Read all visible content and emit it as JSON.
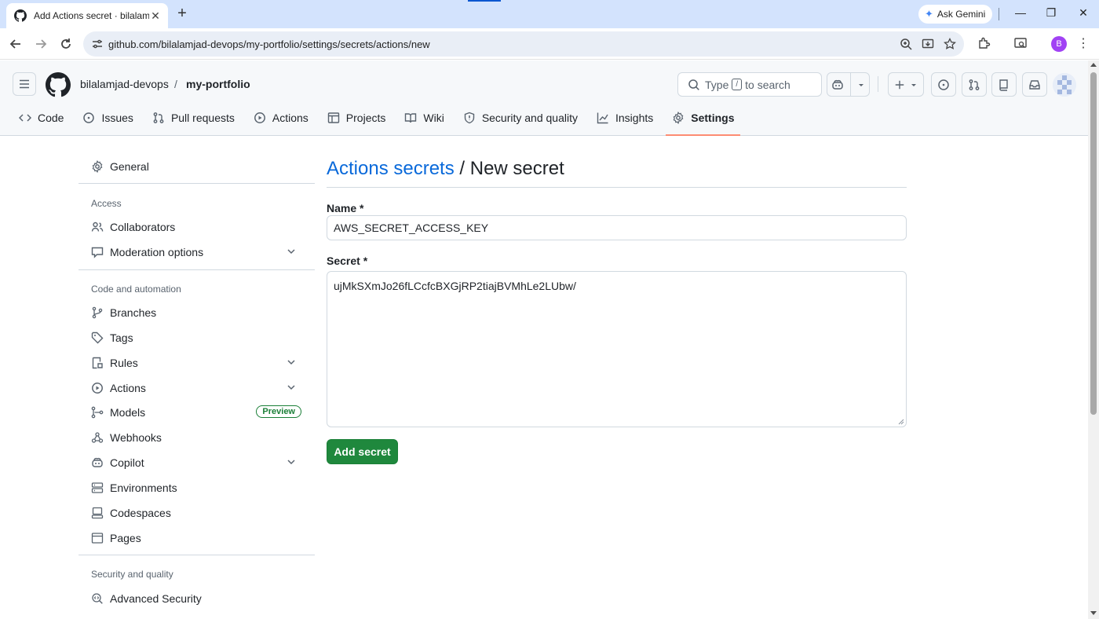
{
  "browser": {
    "tab_title": "Add Actions secret · bilalamjad-",
    "ask_gemini": "Ask Gemini",
    "url": "github.com/bilalamjad-devops/my-portfolio/settings/secrets/actions/new",
    "profile_initial": "B"
  },
  "header": {
    "owner": "bilalamjad-devops",
    "separator": "/",
    "repo": "my-portfolio",
    "search_prefix": "Type",
    "search_key": "/",
    "search_suffix": "to search"
  },
  "repo_nav": [
    {
      "label": "Code",
      "icon": "code-icon"
    },
    {
      "label": "Issues",
      "icon": "issue-icon"
    },
    {
      "label": "Pull requests",
      "icon": "pull-request-icon"
    },
    {
      "label": "Actions",
      "icon": "play-icon"
    },
    {
      "label": "Projects",
      "icon": "table-icon"
    },
    {
      "label": "Wiki",
      "icon": "book-icon"
    },
    {
      "label": "Security and quality",
      "icon": "shield-icon"
    },
    {
      "label": "Insights",
      "icon": "graph-icon"
    },
    {
      "label": "Settings",
      "icon": "gear-icon",
      "active": true
    }
  ],
  "sidebar": {
    "general": "General",
    "sections": {
      "access": "Access",
      "code_automation": "Code and automation",
      "security": "Security and quality"
    },
    "items": {
      "collaborators": "Collaborators",
      "moderation": "Moderation options",
      "branches": "Branches",
      "tags": "Tags",
      "rules": "Rules",
      "actions": "Actions",
      "models": "Models",
      "models_badge": "Preview",
      "webhooks": "Webhooks",
      "copilot": "Copilot",
      "environments": "Environments",
      "codespaces": "Codespaces",
      "pages": "Pages",
      "advanced_security": "Advanced Security"
    }
  },
  "main": {
    "breadcrumb_link": "Actions secrets",
    "breadcrumb_rest": " / New secret",
    "name_label": "Name *",
    "name_value": "AWS_SECRET_ACCESS_KEY",
    "secret_label": "Secret *",
    "secret_value": "ujMkSXmJo26fLCcfcBXGjRP2tiajBVMhLe2LUbw/",
    "submit_label": "Add secret"
  },
  "colors": {
    "accent_link": "#0969da",
    "primary_button": "#1f883d",
    "active_tab_underline": "#fd8c73",
    "chrome_tabbar": "#d3e3fd"
  }
}
